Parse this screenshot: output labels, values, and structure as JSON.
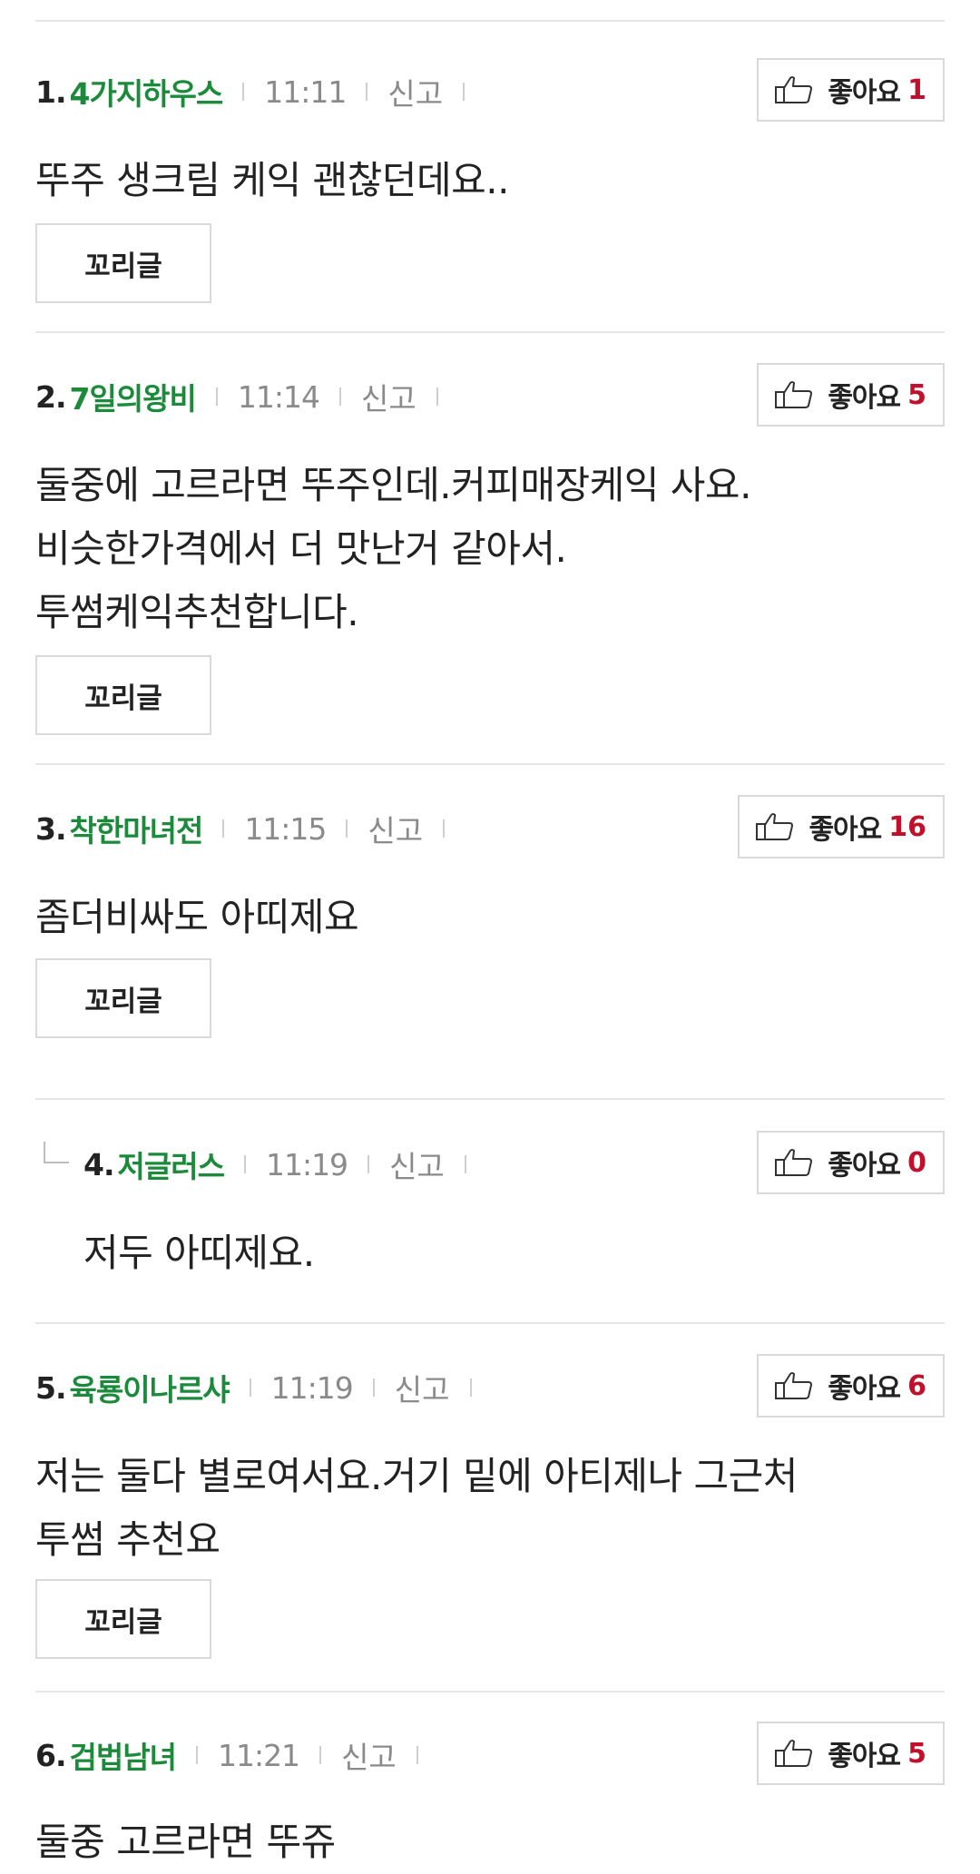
{
  "colors": {
    "author": "#1b8a3a",
    "like_count": "#c0102c",
    "meta": "#8a8a8a",
    "border": "#d9d9d9"
  },
  "like_label": "좋아요",
  "report_label": "신고",
  "tail_label": "꼬리글",
  "comments": [
    {
      "num": "1.",
      "author": "4가지하우스",
      "time": "11:11",
      "likes": "1",
      "lines": [
        "뚜주 생크림 케익 괜찮던데요.."
      ]
    },
    {
      "num": "2.",
      "author": "7일의왕비",
      "time": "11:14",
      "likes": "5",
      "lines": [
        "둘중에 고르라면 뚜주인데.커피매장케익 사요.",
        "비슷한가격에서 더 맛난거 같아서.",
        "투썸케익추천합니다."
      ]
    },
    {
      "num": "3.",
      "author": "착한마녀전",
      "time": "11:15",
      "likes": "16",
      "lines": [
        "좀더비싸도 아띠제요"
      ]
    },
    {
      "num": "4.",
      "author": "저글러스",
      "time": "11:19",
      "likes": "0",
      "lines": [
        "저두 아띠제요."
      ]
    },
    {
      "num": "5.",
      "author": "육룡이나르샤",
      "time": "11:19",
      "likes": "6",
      "lines": [
        "저는 둘다 별로여서요.거기 밑에 아티제나 그근처",
        "투썸 추천요"
      ]
    },
    {
      "num": "6.",
      "author": "검법남녀",
      "time": "11:21",
      "likes": "5",
      "lines": [
        "둘중 고르라면 뚜쥬"
      ]
    }
  ]
}
